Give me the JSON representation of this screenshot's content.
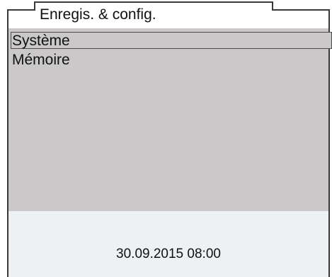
{
  "header": {
    "title": "Enregis. & config."
  },
  "menu": {
    "items": [
      {
        "label": "Système",
        "selected": true
      },
      {
        "label": "Mémoire",
        "selected": false
      }
    ]
  },
  "status": {
    "datetime": "30.09.2015 08:00"
  },
  "colors": {
    "menu_background": "#cac8c8",
    "status_background": "#eef1f3",
    "frame": "#3a3a3a",
    "text": "#111111"
  }
}
